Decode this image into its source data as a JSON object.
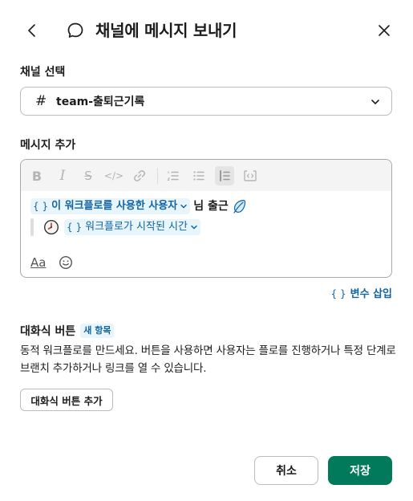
{
  "header": {
    "title": "채널에 메시지 보내기",
    "back_icon": "chevron-left-icon",
    "title_icon": "speech-bubble-icon",
    "close_icon": "close-icon"
  },
  "channel": {
    "label": "채널 선택",
    "hash": "#",
    "value": "team-출퇴근기록"
  },
  "message": {
    "label": "메시지 추가",
    "toolbar_icons": [
      "bold-icon",
      "italic-icon",
      "strikethrough-icon",
      "code-icon",
      "link-icon",
      "ordered-list-icon",
      "bullet-list-icon",
      "blockquote-icon",
      "code-block-icon"
    ],
    "line1": {
      "brace": "{ }",
      "variable": "이 워크플로를 사용한 사용자",
      "text": "님 출근"
    },
    "line2": {
      "brace": "{ }",
      "variable": "워크플로가 시작된 시간"
    },
    "format_label": "Aa",
    "emoji_icon": "smile-icon"
  },
  "insert_variable": {
    "brace": "{ }",
    "label": "변수 삽입"
  },
  "interactive_button": {
    "title": "대화식 버튼",
    "badge": "새 항목",
    "description": "동적 워크플로를 만드세요. 버튼을 사용하면 사용자는 플로를 진행하거나 특정 단계로 브랜치 추가하거나 링크를 열 수 있습니다.",
    "add_label": "대화식 버튼 추가"
  },
  "footer": {
    "cancel_label": "취소",
    "save_label": "저장"
  },
  "colors": {
    "accent_green": "#007a5a",
    "link_blue": "#1264a3",
    "chip_bg": "#e8f5fa"
  }
}
